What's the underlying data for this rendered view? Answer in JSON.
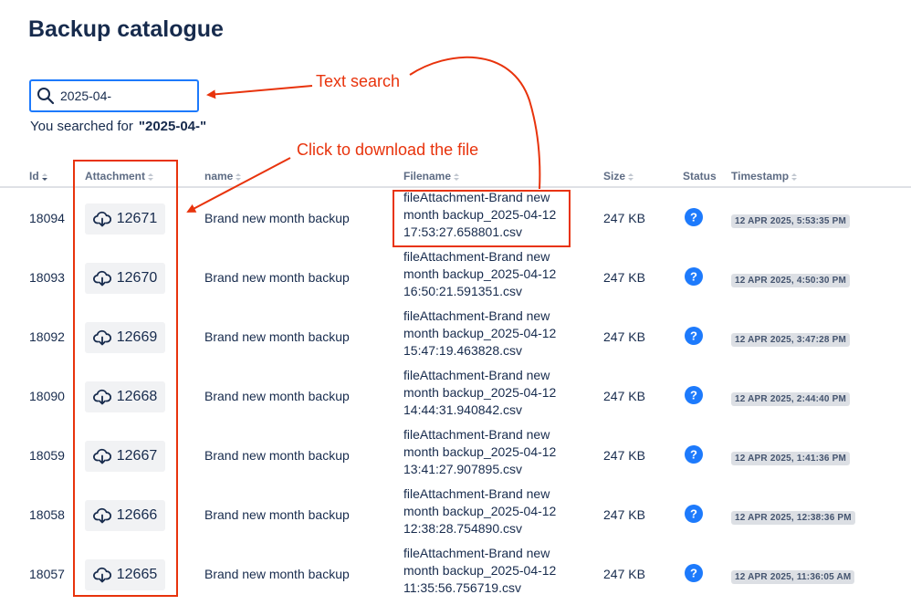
{
  "page": {
    "title": "Backup catalogue"
  },
  "search": {
    "value": "2025-04-",
    "searched_prefix": "You searched for",
    "searched_term": "\"2025-04-\""
  },
  "table": {
    "headers": {
      "id": "Id",
      "attachment": "Attachment",
      "name": "name",
      "filename": "Filename",
      "size": "Size",
      "status": "Status",
      "timestamp": "Timestamp"
    },
    "rows": [
      {
        "id": "18094",
        "attachment": "12671",
        "name": "Brand new month backup",
        "filename": [
          "fileAttachment-Brand new",
          "month backup_2025-04-12",
          "17:53:27.658801.csv"
        ],
        "size": "247 KB",
        "status": "?",
        "timestamp": "12 APR 2025, 5:53:35 PM"
      },
      {
        "id": "18093",
        "attachment": "12670",
        "name": "Brand new month backup",
        "filename": [
          "fileAttachment-Brand new",
          "month backup_2025-04-12",
          "16:50:21.591351.csv"
        ],
        "size": "247 KB",
        "status": "?",
        "timestamp": "12 APR 2025, 4:50:30 PM"
      },
      {
        "id": "18092",
        "attachment": "12669",
        "name": "Brand new month backup",
        "filename": [
          "fileAttachment-Brand new",
          "month backup_2025-04-12",
          "15:47:19.463828.csv"
        ],
        "size": "247 KB",
        "status": "?",
        "timestamp": "12 APR 2025, 3:47:28 PM"
      },
      {
        "id": "18090",
        "attachment": "12668",
        "name": "Brand new month backup",
        "filename": [
          "fileAttachment-Brand new",
          "month backup_2025-04-12",
          "14:44:31.940842.csv"
        ],
        "size": "247 KB",
        "status": "?",
        "timestamp": "12 APR 2025, 2:44:40 PM"
      },
      {
        "id": "18059",
        "attachment": "12667",
        "name": "Brand new month backup",
        "filename": [
          "fileAttachment-Brand new",
          "month backup_2025-04-12",
          "13:41:27.907895.csv"
        ],
        "size": "247 KB",
        "status": "?",
        "timestamp": "12 APR 2025, 1:41:36 PM"
      },
      {
        "id": "18058",
        "attachment": "12666",
        "name": "Brand new month backup",
        "filename": [
          "fileAttachment-Brand new",
          "month backup_2025-04-12",
          "12:38:28.754890.csv"
        ],
        "size": "247 KB",
        "status": "?",
        "timestamp": "12 APR 2025, 12:38:36 PM"
      },
      {
        "id": "18057",
        "attachment": "12665",
        "name": "Brand new month backup",
        "filename": [
          "fileAttachment-Brand new",
          "month backup_2025-04-12",
          "11:35:56.756719.csv"
        ],
        "size": "247 KB",
        "status": "?",
        "timestamp": "12 APR 2025, 11:36:05 AM"
      }
    ]
  },
  "annotations": {
    "text_search": "Text search",
    "click_download": "Click to download the file"
  },
  "icons": {
    "search": "search-icon",
    "download": "cloud-download-icon",
    "status": "question-circle-icon",
    "sort": "sort-arrows-icon"
  },
  "colors": {
    "accent": "#1d7afc",
    "annotation": "#e8330c",
    "status": "#1d7afc",
    "title": "#172b4d"
  }
}
